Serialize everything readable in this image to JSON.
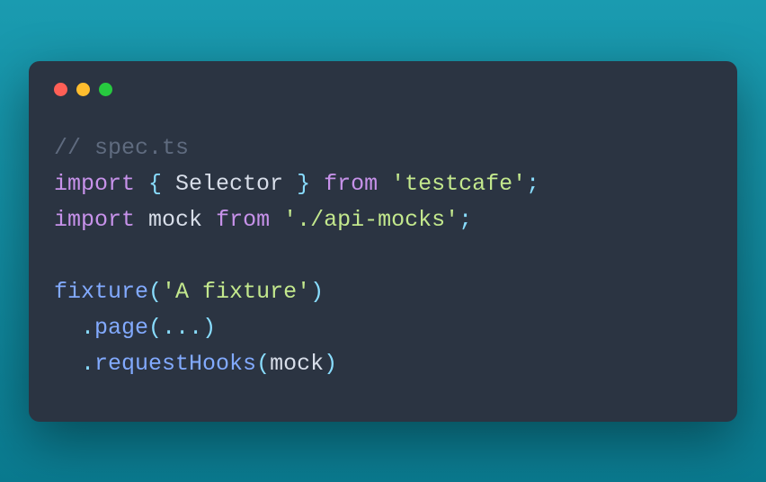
{
  "code": {
    "comment": "// spec.ts",
    "line1": {
      "kw_import": "import",
      "brace_open": " { ",
      "identifier": "Selector",
      "brace_close": " } ",
      "kw_from": "from",
      "space": " ",
      "string": "'testcafe'",
      "semi": ";"
    },
    "line2": {
      "kw_import": "import",
      "space1": " ",
      "identifier": "mock",
      "space2": " ",
      "kw_from": "from",
      "space3": " ",
      "string": "'./api-mocks'",
      "semi": ";"
    },
    "line4": {
      "func": "fixture",
      "paren_open": "(",
      "string": "'A fixture'",
      "paren_close": ")"
    },
    "line5": {
      "indent": "  ",
      "dot": ".",
      "method": "page",
      "paren_open": "(",
      "spread": "...",
      "paren_close": ")"
    },
    "line6": {
      "indent": "  ",
      "dot": ".",
      "method": "requestHooks",
      "paren_open": "(",
      "arg": "mock",
      "paren_close": ")"
    }
  }
}
